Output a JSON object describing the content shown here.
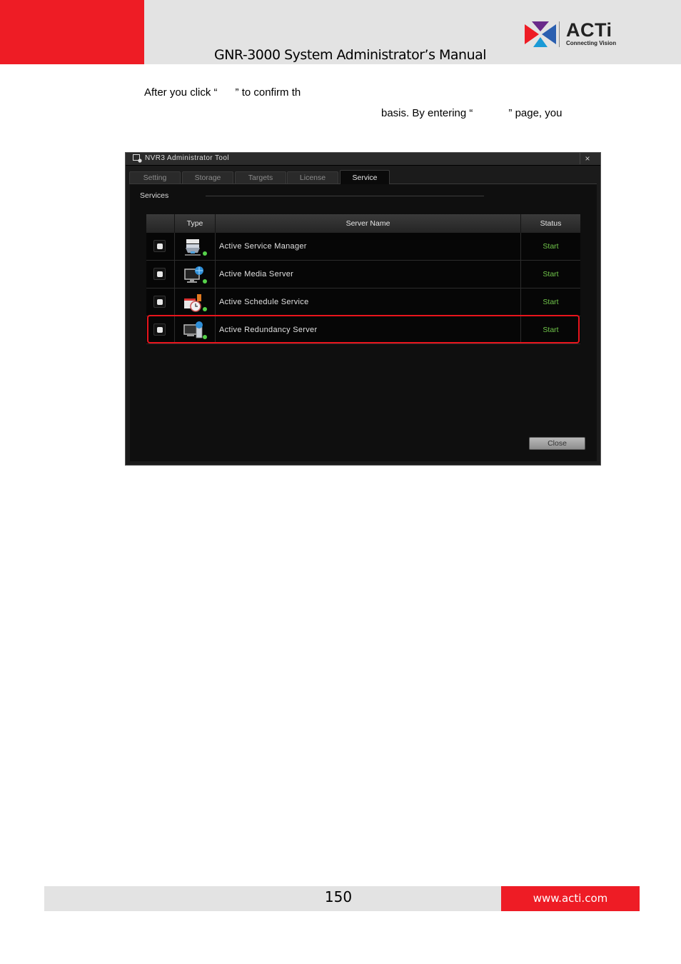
{
  "header": {
    "manual_title": "GNR-3000 System Administrator’s Manual",
    "logo_word": "ACTi",
    "logo_tagline": "Connecting Vision"
  },
  "body_text": {
    "line1": "After you click “      ” to confirm th",
    "line2": "basis. By entering “            ” page, you"
  },
  "window": {
    "title": "NVR3 Administrator Tool",
    "close_glyph": "×",
    "tabs": [
      {
        "label": "Setting",
        "active": false
      },
      {
        "label": "Storage",
        "active": false
      },
      {
        "label": "Targets",
        "active": false
      },
      {
        "label": "License",
        "active": false
      },
      {
        "label": "Service",
        "active": true
      }
    ],
    "section_label": "Services",
    "table": {
      "headers": [
        "",
        "Type",
        "Server Name",
        "Status"
      ],
      "rows": [
        {
          "icon": "service-manager-icon",
          "name": "Active Service Manager",
          "status": "Start"
        },
        {
          "icon": "media-server-icon",
          "name": "Active Media Server",
          "status": "Start"
        },
        {
          "icon": "schedule-service-icon",
          "name": "Active Schedule Service",
          "status": "Start"
        },
        {
          "icon": "redundancy-server-icon",
          "name": "Active Redundancy Server",
          "status": "Start"
        }
      ]
    },
    "close_button": "Close"
  },
  "footer": {
    "page_number": "150",
    "website": "www.acti.com"
  },
  "colors": {
    "brand_red": "#ee1c25",
    "status_green": "#70c54a",
    "highlight_red": "#e8141c"
  }
}
